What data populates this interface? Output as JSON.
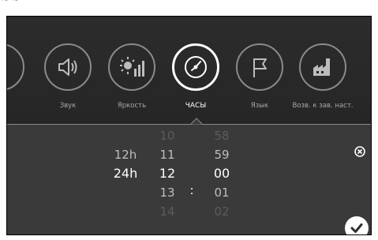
{
  "menu": {
    "items": [
      {
        "label": "",
        "icon": "partial-icon"
      },
      {
        "label": "Звук",
        "icon": "speaker-icon"
      },
      {
        "label": "Яркость",
        "icon": "brightness-icon"
      },
      {
        "label": "ЧАСЫ",
        "icon": "clock-icon"
      },
      {
        "label": "Язык",
        "icon": "flag-icon"
      },
      {
        "label": "Возв. к зав. наст.",
        "icon": "factory-icon"
      }
    ],
    "active_index": 3
  },
  "clock_picker": {
    "formats": [
      "12h",
      "24h"
    ],
    "selected_format": "24h",
    "hours": [
      "10",
      "11",
      "12",
      "13",
      "14"
    ],
    "selected_hour": "12",
    "separator": ":",
    "minutes": [
      "58",
      "59",
      "00",
      "01",
      "02"
    ],
    "selected_minute": "00"
  },
  "colors": {
    "background": "#2f2f2f",
    "panel": "#3a3a3a",
    "accent": "#ffffff",
    "inactive_ring": "#8a8a8a"
  }
}
